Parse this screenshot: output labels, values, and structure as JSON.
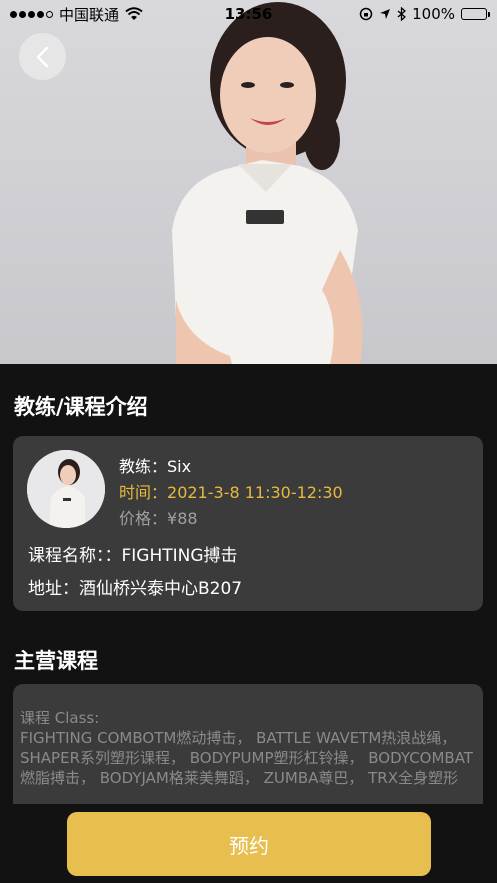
{
  "status_bar": {
    "carrier": "中国联通",
    "time": "13:56",
    "battery": "100%"
  },
  "section1_title": "教练/课程介绍",
  "coach_card": {
    "coach_label": "教练：",
    "coach_name": "Six",
    "time_label": "时间：",
    "time_value": "2021-3-8 11:30-12:30",
    "price_label": "价格：",
    "price_value": "¥88",
    "course_name_label": "课程名称：",
    "course_name_value": "：FIGHTING搏击",
    "address_label": "地址：",
    "address_value": "酒仙桥兴泰中心B207"
  },
  "section2_title": "主营课程",
  "main_courses": {
    "label": "课程 Class:",
    "text": "FIGHTING COMBOTM燃动搏击， BATTLE WAVETM热浪战绳， SHAPER系列塑形课程， BODYPUMP塑形杠铃操， BODYCOMBAT燃脂搏击， BODYJAM格莱美舞蹈， ZUMBA尊巴， TRX全身塑形"
  },
  "book_button": "预约",
  "colors": {
    "accent_gold": "#e8b93c",
    "button_gold": "#e8bf4f",
    "card_bg": "#3b3b3b",
    "page_bg": "#121212"
  }
}
